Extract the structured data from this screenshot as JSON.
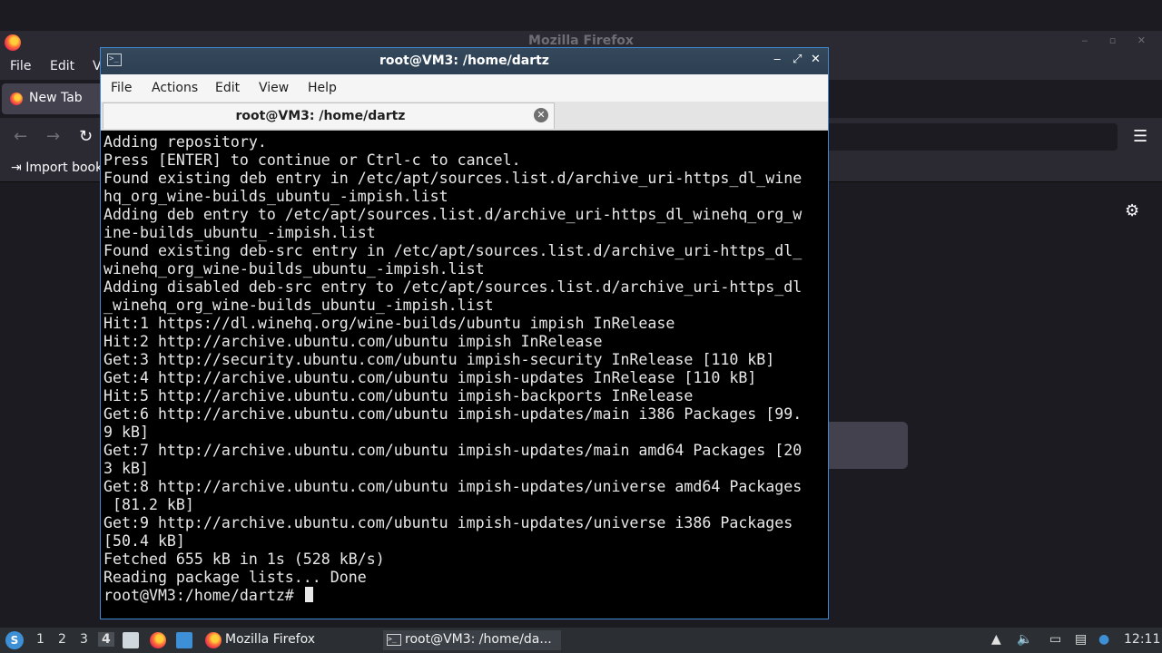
{
  "firefox": {
    "window_title": "Mozilla Firefox",
    "menu": {
      "file": "File",
      "edit": "Edit",
      "view": "V"
    },
    "tab_label": "New Tab",
    "bookmarks_item": "Import book",
    "icons": [
      "firefox-logo-icon",
      "back-arrow-icon",
      "forward-arrow-icon",
      "reload-icon",
      "hamburger-menu-icon",
      "gear-icon",
      "import-icon"
    ]
  },
  "terminal": {
    "title": "root@VM3: /home/dartz",
    "menu": [
      "File",
      "Actions",
      "Edit",
      "View",
      "Help"
    ],
    "tab_label": "root@VM3: /home/dartz",
    "output_lines": [
      "Adding repository.",
      "Press [ENTER] to continue or Ctrl-c to cancel.",
      "Found existing deb entry in /etc/apt/sources.list.d/archive_uri-https_dl_wine",
      "hq_org_wine-builds_ubuntu_-impish.list",
      "Adding deb entry to /etc/apt/sources.list.d/archive_uri-https_dl_winehq_org_w",
      "ine-builds_ubuntu_-impish.list",
      "Found existing deb-src entry in /etc/apt/sources.list.d/archive_uri-https_dl_",
      "winehq_org_wine-builds_ubuntu_-impish.list",
      "Adding disabled deb-src entry to /etc/apt/sources.list.d/archive_uri-https_dl",
      "_winehq_org_wine-builds_ubuntu_-impish.list",
      "Hit:1 https://dl.winehq.org/wine-builds/ubuntu impish InRelease",
      "Hit:2 http://archive.ubuntu.com/ubuntu impish InRelease",
      "Get:3 http://security.ubuntu.com/ubuntu impish-security InRelease [110 kB]",
      "Get:4 http://archive.ubuntu.com/ubuntu impish-updates InRelease [110 kB]",
      "Hit:5 http://archive.ubuntu.com/ubuntu impish-backports InRelease",
      "Get:6 http://archive.ubuntu.com/ubuntu impish-updates/main i386 Packages [99.",
      "9 kB]",
      "Get:7 http://archive.ubuntu.com/ubuntu impish-updates/main amd64 Packages [20",
      "3 kB]",
      "Get:8 http://archive.ubuntu.com/ubuntu impish-updates/universe amd64 Packages",
      " [81.2 kB]",
      "Get:9 http://archive.ubuntu.com/ubuntu impish-updates/universe i386 Packages",
      "[50.4 kB]",
      "Fetched 655 kB in 1s (528 kB/s)",
      "Reading package lists... Done"
    ],
    "prompt": "root@VM3:/home/dartz# "
  },
  "taskbar": {
    "workspaces": [
      "1",
      "2",
      "3",
      "4"
    ],
    "active_workspace": "4",
    "tasks": [
      {
        "label": "Mozilla Firefox",
        "icon": "firefox-icon"
      },
      {
        "label": "root@VM3: /home/da...",
        "icon": "terminal-icon"
      }
    ],
    "clock": "12:11"
  }
}
